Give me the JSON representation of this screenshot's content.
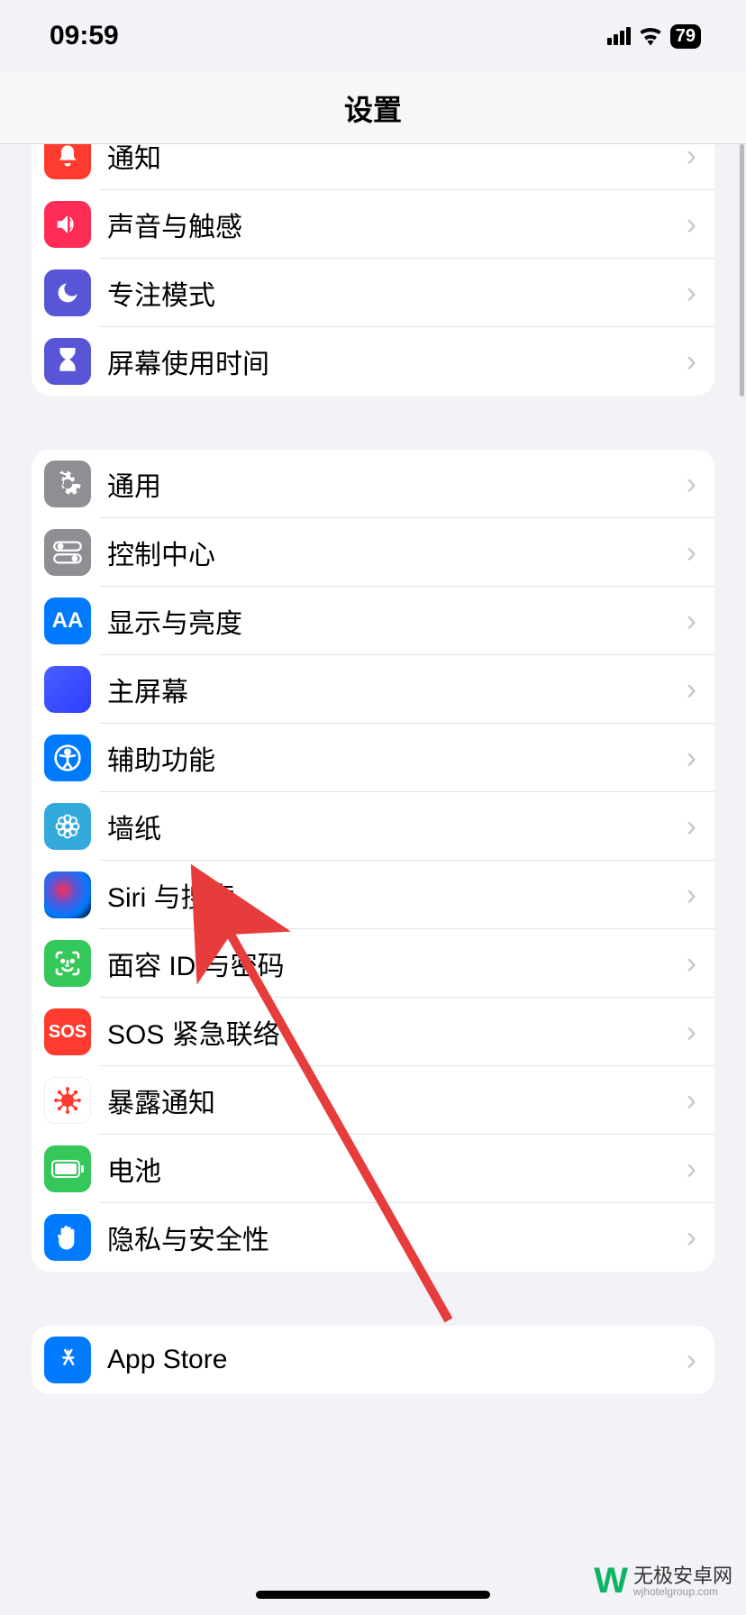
{
  "status": {
    "time": "09:59",
    "battery": "79"
  },
  "header": {
    "title": "设置"
  },
  "groups": [
    {
      "rows": [
        {
          "id": "notifications",
          "label": "通知",
          "iconClass": "bg-red",
          "glyph": "bell"
        },
        {
          "id": "sounds",
          "label": "声音与触感",
          "iconClass": "bg-pink",
          "glyph": "speaker"
        },
        {
          "id": "focus",
          "label": "专注模式",
          "iconClass": "bg-indigo",
          "glyph": "moon"
        },
        {
          "id": "screen-time",
          "label": "屏幕使用时间",
          "iconClass": "bg-indigo",
          "glyph": "hourglass"
        }
      ]
    },
    {
      "rows": [
        {
          "id": "general",
          "label": "通用",
          "iconClass": "bg-gray",
          "glyph": "gear"
        },
        {
          "id": "control-center",
          "label": "控制中心",
          "iconClass": "bg-graylight",
          "glyph": "switches"
        },
        {
          "id": "display",
          "label": "显示与亮度",
          "iconClass": "bg-blue",
          "glyph": "AA"
        },
        {
          "id": "home-screen",
          "label": "主屏幕",
          "iconClass": "home-grid",
          "glyph": "grid"
        },
        {
          "id": "accessibility",
          "label": "辅助功能",
          "iconClass": "bg-blue",
          "glyph": "accessibility"
        },
        {
          "id": "wallpaper",
          "label": "墙纸",
          "iconClass": "bg-cyan",
          "glyph": "flower"
        },
        {
          "id": "siri",
          "label": "Siri 与搜索",
          "iconClass": "bg-siri",
          "glyph": ""
        },
        {
          "id": "face-id",
          "label": "面容 ID 与密码",
          "iconClass": "bg-green",
          "glyph": "face"
        },
        {
          "id": "sos",
          "label": "SOS 紧急联络",
          "iconClass": "bg-sos",
          "glyph": "SOS"
        },
        {
          "id": "exposure",
          "label": "暴露通知",
          "iconClass": "bg-white exposure-icon",
          "glyph": "virus"
        },
        {
          "id": "battery",
          "label": "电池",
          "iconClass": "bg-green",
          "glyph": "battery"
        },
        {
          "id": "privacy",
          "label": "隐私与安全性",
          "iconClass": "bg-blue",
          "glyph": "hand"
        }
      ]
    },
    {
      "rows": [
        {
          "id": "app-store",
          "label": "App Store",
          "iconClass": "bg-blue",
          "glyph": "appstore"
        }
      ]
    }
  ],
  "watermark": {
    "main": "无极安卓网",
    "sub": "wjhotelgroup.com"
  }
}
